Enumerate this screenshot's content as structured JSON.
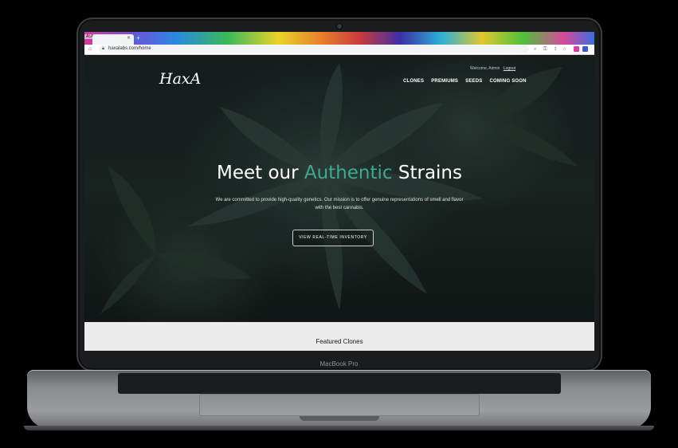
{
  "device": {
    "label": "MacBook Pro"
  },
  "browser": {
    "tab_title": "ALA",
    "url": "haxalabs.com/home"
  },
  "site": {
    "logo_text": "HaxA",
    "welcome_text": "Welcome, Admin",
    "logout_label": "Logout",
    "nav": [
      {
        "label": "CLONES"
      },
      {
        "label": "PREMIUMS"
      },
      {
        "label": "SEEDS"
      },
      {
        "label": "COMING SOON"
      }
    ],
    "headline": {
      "part1": "Meet our ",
      "accent": "Authentic",
      "part2": " Strains"
    },
    "subtext": "We are committed to provide high-quality genetics. Our mission is to offer genuine representations of smell and flavor with the best cannabis.",
    "cta_label": "VIEW REAL-TIME INVENTORY",
    "featured_title": "Featured Clones"
  },
  "colors": {
    "accent": "#3fa98f",
    "hero_bg": "#18221f",
    "featured_bg": "#ececec"
  }
}
